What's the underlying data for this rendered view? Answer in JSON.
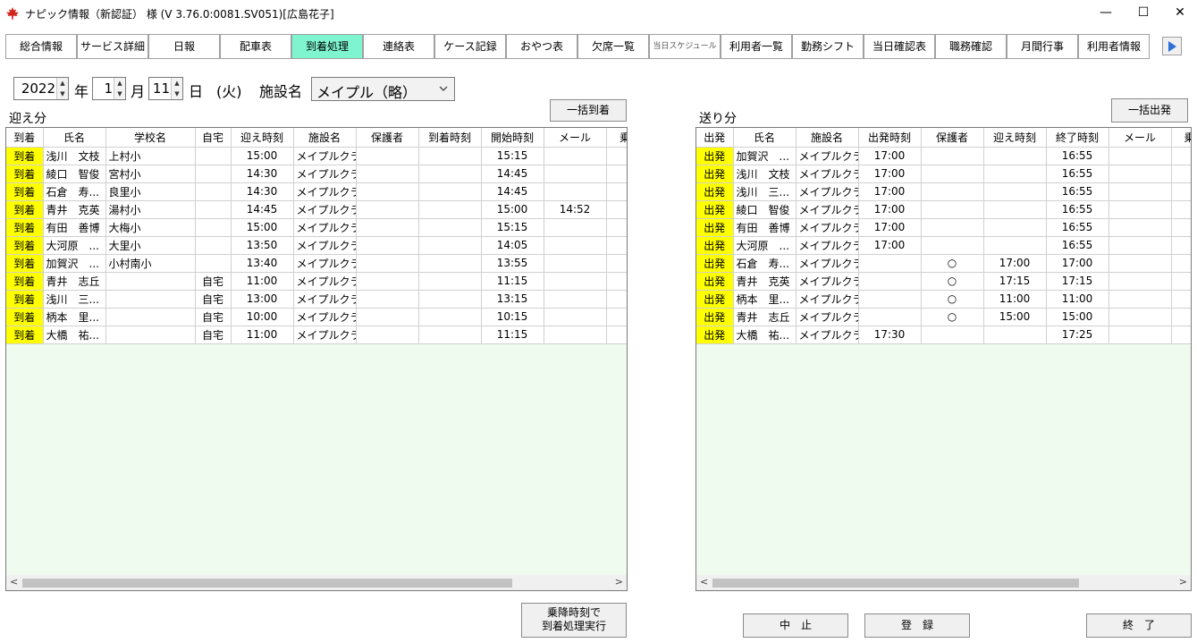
{
  "window": {
    "title": "ナピック情報（新認証）  様 (V 3.76.0:0081.SV051)[広島花子]",
    "minimize": "—",
    "maximize": "☐",
    "close": "✕"
  },
  "tabs": [
    "総合情報",
    "サービス詳細",
    "日報",
    "配車表",
    "到着処理",
    "連絡表",
    "ケース記録",
    "おやつ表",
    "欠席一覧",
    "当日スケジュール",
    "利用者一覧",
    "勤務シフト",
    "当日確認表",
    "職務確認",
    "月間行事",
    "利用者情報"
  ],
  "active_tab": "到着処理",
  "date": {
    "year": "2022",
    "year_label": "年",
    "month": "1",
    "month_label": "月",
    "day": "11",
    "day_label": "日",
    "weekday": "(火)",
    "facility_label": "施設名",
    "facility": "メイプル（略）"
  },
  "pickup": {
    "label": "迎え分",
    "bulk_button": "一括到着",
    "columns": [
      "到着",
      "氏名",
      "学校名",
      "自宅",
      "迎え時刻",
      "施設名",
      "保護者",
      "到着時刻",
      "開始時刻",
      "メール",
      "乗"
    ],
    "rows": [
      {
        "action": "到着",
        "name": "浅川　文枝",
        "school": "上村小",
        "home": "",
        "pickup_time": "15:00",
        "facility": "メイプルクラブ",
        "guardian": "",
        "arrival": "",
        "start": "15:15",
        "mail": ""
      },
      {
        "action": "到着",
        "name": "綾口　智俊",
        "school": "宮村小",
        "home": "",
        "pickup_time": "14:30",
        "facility": "メイプルクラブ",
        "guardian": "",
        "arrival": "",
        "start": "14:45",
        "mail": ""
      },
      {
        "action": "到着",
        "name": "石倉　寿...",
        "school": "良里小",
        "home": "",
        "pickup_time": "14:30",
        "facility": "メイプルクラブ",
        "guardian": "",
        "arrival": "",
        "start": "14:45",
        "mail": ""
      },
      {
        "action": "到着",
        "name": "青井　克英",
        "school": "湯村小",
        "home": "",
        "pickup_time": "14:45",
        "facility": "メイプルクラブ",
        "guardian": "",
        "arrival": "",
        "start": "15:00",
        "mail": "14:52"
      },
      {
        "action": "到着",
        "name": "有田　善博",
        "school": "大梅小",
        "home": "",
        "pickup_time": "15:00",
        "facility": "メイプルクラブ",
        "guardian": "",
        "arrival": "",
        "start": "15:15",
        "mail": ""
      },
      {
        "action": "到着",
        "name": "大河原　...",
        "school": "大里小",
        "home": "",
        "pickup_time": "13:50",
        "facility": "メイプルクラブ",
        "guardian": "",
        "arrival": "",
        "start": "14:05",
        "mail": ""
      },
      {
        "action": "到着",
        "name": "加賀沢　...",
        "school": "小村南小",
        "home": "",
        "pickup_time": "13:40",
        "facility": "メイプルクラブ",
        "guardian": "",
        "arrival": "",
        "start": "13:55",
        "mail": ""
      },
      {
        "action": "到着",
        "name": "青井　志丘",
        "school": "",
        "home": "自宅",
        "pickup_time": "11:00",
        "facility": "メイプルクラブ",
        "guardian": "",
        "arrival": "",
        "start": "11:15",
        "mail": ""
      },
      {
        "action": "到着",
        "name": "浅川　三...",
        "school": "",
        "home": "自宅",
        "pickup_time": "13:00",
        "facility": "メイプルクラブ",
        "guardian": "",
        "arrival": "",
        "start": "13:15",
        "mail": ""
      },
      {
        "action": "到着",
        "name": "柄本　里...",
        "school": "",
        "home": "自宅",
        "pickup_time": "10:00",
        "facility": "メイプルクラブ",
        "guardian": "",
        "arrival": "",
        "start": "10:15",
        "mail": ""
      },
      {
        "action": "到着",
        "name": "大橋　祐...",
        "school": "",
        "home": "自宅",
        "pickup_time": "11:00",
        "facility": "メイプルクラブ",
        "guardian": "",
        "arrival": "",
        "start": "11:15",
        "mail": ""
      }
    ]
  },
  "dropoff": {
    "label": "送り分",
    "bulk_button": "一括出発",
    "columns": [
      "出発",
      "氏名",
      "施設名",
      "出発時刻",
      "保護者",
      "迎え時刻",
      "終了時刻",
      "メール",
      "乗"
    ],
    "rows": [
      {
        "action": "出発",
        "name": "加賀沢　...",
        "facility": "メイプルクラブ",
        "depart": "17:00",
        "guardian": "",
        "pickup": "",
        "end": "16:55",
        "mail": ""
      },
      {
        "action": "出発",
        "name": "浅川　文枝",
        "facility": "メイプルクラブ",
        "depart": "17:00",
        "guardian": "",
        "pickup": "",
        "end": "16:55",
        "mail": ""
      },
      {
        "action": "出発",
        "name": "浅川　三...",
        "facility": "メイプルクラブ",
        "depart": "17:00",
        "guardian": "",
        "pickup": "",
        "end": "16:55",
        "mail": ""
      },
      {
        "action": "出発",
        "name": "綾口　智俊",
        "facility": "メイプルクラブ",
        "depart": "17:00",
        "guardian": "",
        "pickup": "",
        "end": "16:55",
        "mail": ""
      },
      {
        "action": "出発",
        "name": "有田　善博",
        "facility": "メイプルクラブ",
        "depart": "17:00",
        "guardian": "",
        "pickup": "",
        "end": "16:55",
        "mail": ""
      },
      {
        "action": "出発",
        "name": "大河原　...",
        "facility": "メイプルクラブ",
        "depart": "17:00",
        "guardian": "",
        "pickup": "",
        "end": "16:55",
        "mail": ""
      },
      {
        "action": "出発",
        "name": "石倉　寿...",
        "facility": "メイプルクラブ",
        "depart": "",
        "guardian": "○",
        "pickup": "17:00",
        "end": "17:00",
        "mail": ""
      },
      {
        "action": "出発",
        "name": "青井　克英",
        "facility": "メイプルクラブ",
        "depart": "",
        "guardian": "○",
        "pickup": "17:15",
        "end": "17:15",
        "mail": ""
      },
      {
        "action": "出発",
        "name": "柄本　里...",
        "facility": "メイプルクラブ",
        "depart": "",
        "guardian": "○",
        "pickup": "11:00",
        "end": "11:00",
        "mail": ""
      },
      {
        "action": "出発",
        "name": "青井　志丘",
        "facility": "メイプルクラブ",
        "depart": "",
        "guardian": "○",
        "pickup": "15:00",
        "end": "15:00",
        "mail": ""
      },
      {
        "action": "出発",
        "name": "大橋　祐...",
        "facility": "メイプルクラブ",
        "depart": "17:30",
        "guardian": "",
        "pickup": "",
        "end": "17:25",
        "mail": ""
      }
    ]
  },
  "buttons": {
    "execute_line1": "乗降時刻で",
    "execute_line2": "到着処理実行",
    "cancel": "中　止",
    "register": "登　録",
    "exit": "終　了"
  },
  "colors": {
    "active_tab": "#7ff5cf",
    "action_cell": "#ffff00",
    "grid_empty": "#effbef"
  }
}
